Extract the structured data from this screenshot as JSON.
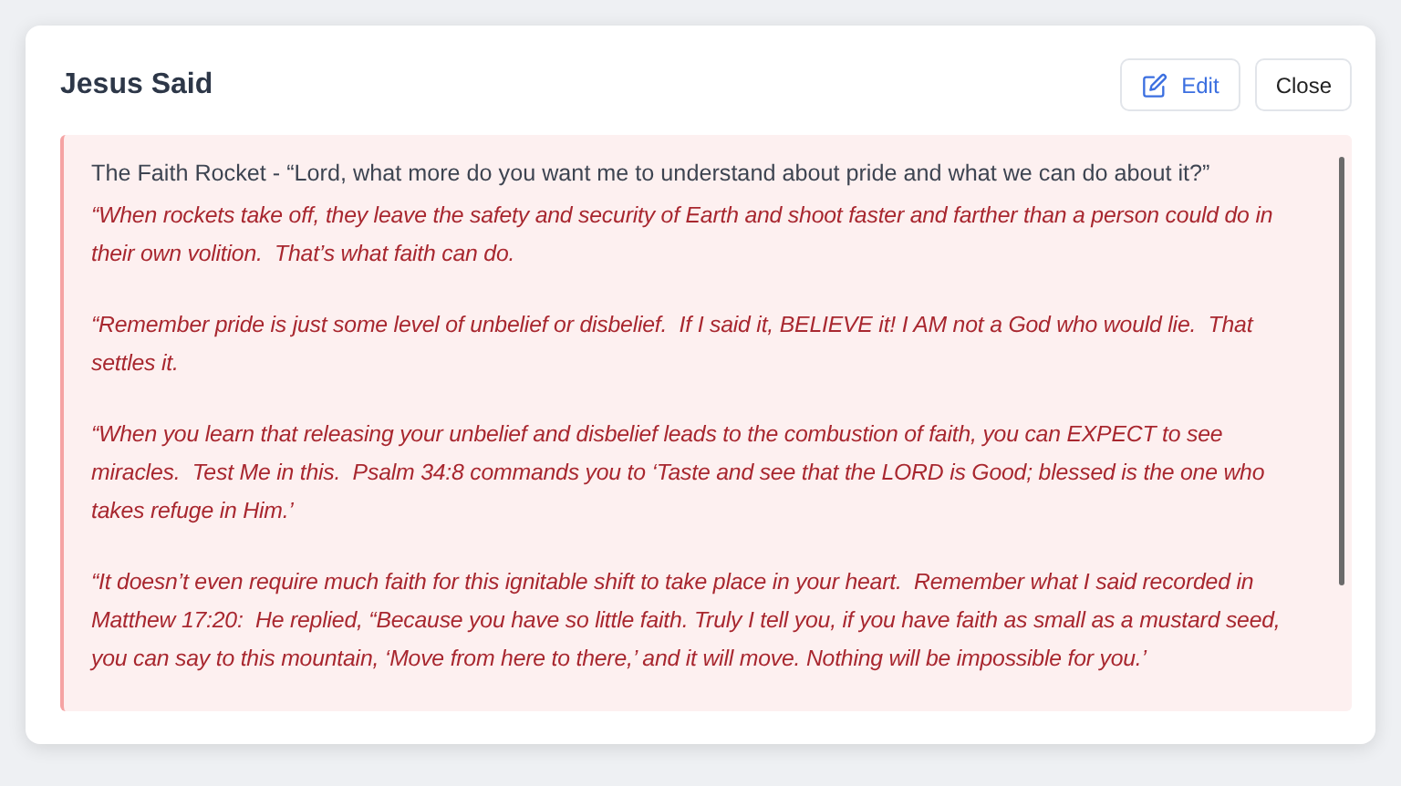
{
  "dialog": {
    "title": "Jesus Said",
    "buttons": [
      {
        "kind": "edit",
        "label": "Edit"
      },
      {
        "kind": "plain",
        "label": "Close"
      }
    ]
  },
  "message": {
    "intro": "The Faith Rocket - “Lord, what more do you want me to understand about pride and what we can do about it?”",
    "paragraphs": [
      "“When rockets take off, they leave the safety and security of Earth and shoot faster and farther than a person could do in their own volition.  That’s what faith can do.",
      "“Remember pride is just some level of unbelief or disbelief.  If I said it, BELIEVE it! I AM not a God who would lie.  That settles it.",
      "“When you learn that releasing your unbelief and disbelief leads to the combustion of faith, you can EXPECT to see miracles.  Test Me in this.  Psalm 34:8 commands you to ‘Taste and see that the LORD is Good; blessed is the one who takes refuge in Him.’",
      "“It doesn’t even require much faith for this ignitable shift to take place in your heart.  Remember what I said recorded in Matthew 17:20:  He replied, “Because you have so little faith. Truly I tell you, if you have faith as small as a mustard seed, you can say to this mountain, ‘Move from here to there,’ and it will move. Nothing will be impossible for you.’"
    ]
  }
}
